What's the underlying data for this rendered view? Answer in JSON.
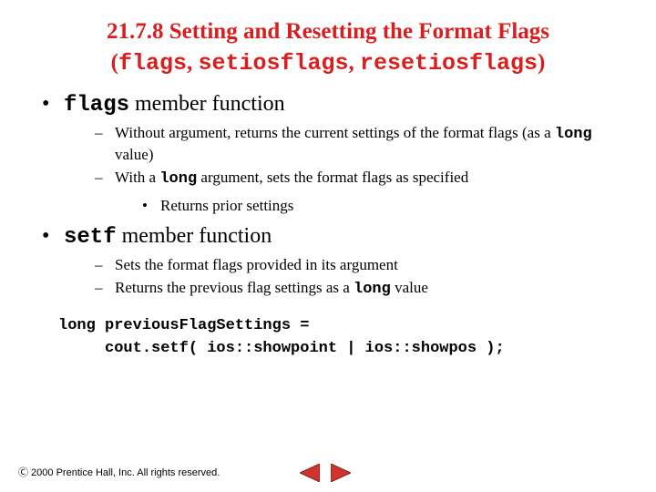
{
  "title": {
    "line1": "21.7.8  Setting and Resetting the Format Flags",
    "line2_open": "(",
    "line2_a": "flags",
    "line2_sep1": ", ",
    "line2_b": "setiosflags",
    "line2_sep2": ", ",
    "line2_c": "resetiosflags",
    "line2_close": ")"
  },
  "b1": {
    "code": "flags",
    "rest": " member function",
    "d1a": "Without argument, returns the current settings of the format flags (as a ",
    "d1b": "long",
    "d1c": " value)",
    "d2a": "With a ",
    "d2b": "long",
    "d2c": " argument, sets the format flags as specified",
    "s1": "Returns prior settings"
  },
  "b2": {
    "code": "setf",
    "rest": " member function",
    "d1": "Sets the format flags provided in its argument",
    "d2a": "Returns the previous flag settings as a ",
    "d2b": "long",
    "d2c": " value"
  },
  "code": {
    "l1": "long previousFlagSettings =",
    "l2": "     cout.setf( ios::showpoint | ios::showpos );"
  },
  "footer": "Ⓒ 2000 Prentice Hall, Inc.  All rights reserved."
}
